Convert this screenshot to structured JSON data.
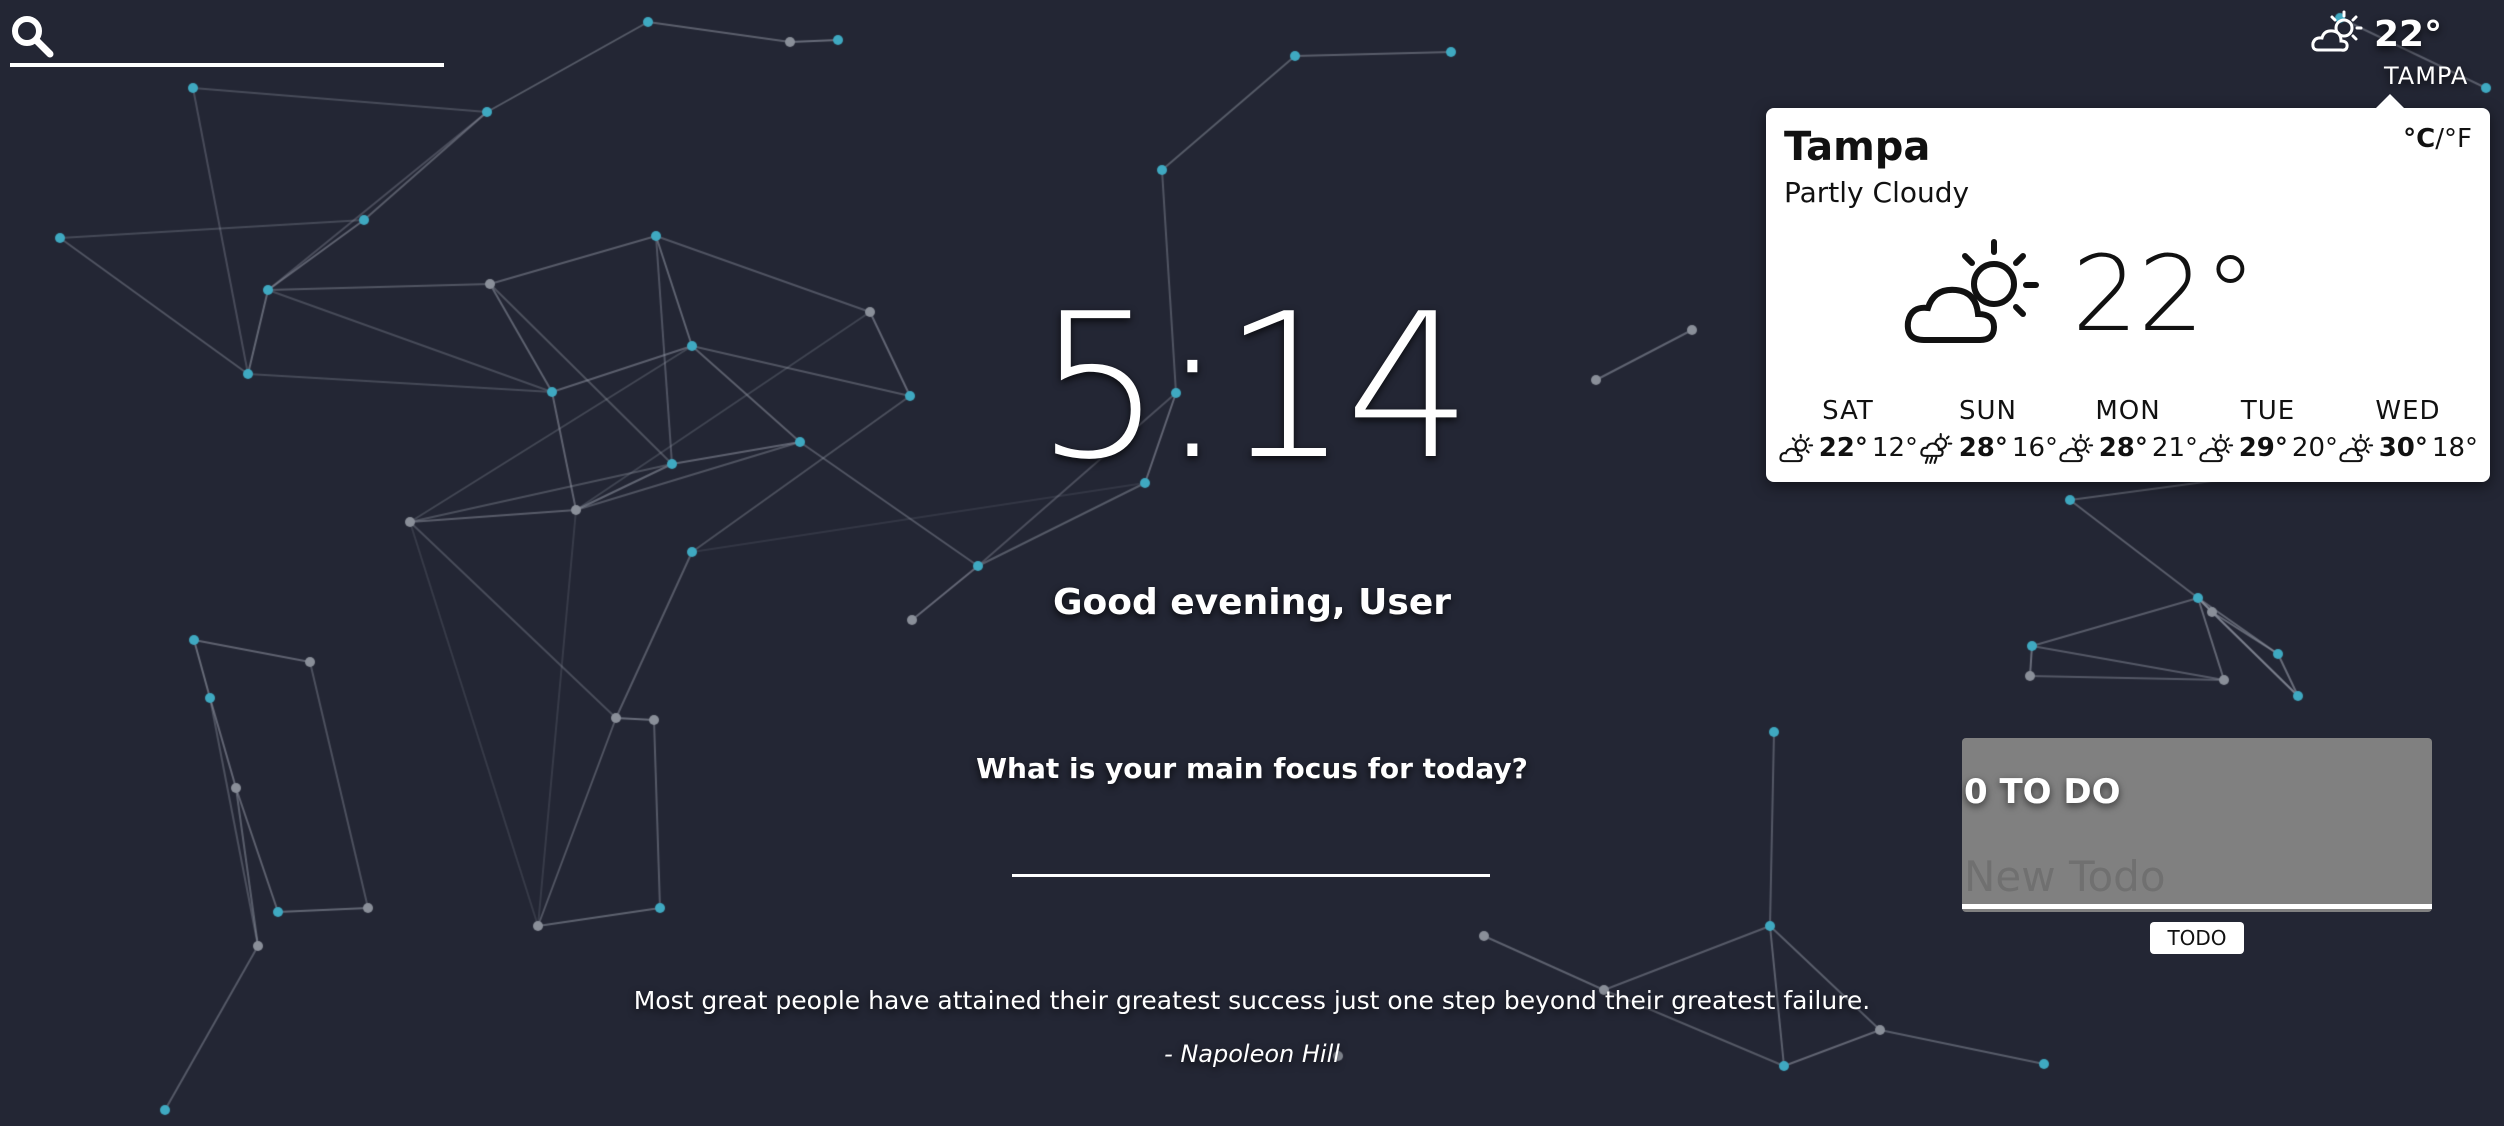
{
  "search": {
    "placeholder": "",
    "value": ""
  },
  "weather_mini": {
    "temp": "22°",
    "city": "TAMPA",
    "icon": "partly-cloudy-icon"
  },
  "weather_card": {
    "city": "Tampa",
    "condition": "Partly Cloudy",
    "unit_c": "°C",
    "unit_sep": "/",
    "unit_f": "°F",
    "temp": "22°",
    "icon": "partly-cloudy-icon",
    "forecast": [
      {
        "day": "SAT",
        "hi": "22°",
        "lo": "12°",
        "icon": "partly-cloudy-icon"
      },
      {
        "day": "SUN",
        "hi": "28°",
        "lo": "16°",
        "icon": "rain-icon"
      },
      {
        "day": "MON",
        "hi": "28°",
        "lo": "21°",
        "icon": "partly-cloudy-icon"
      },
      {
        "day": "TUE",
        "hi": "29°",
        "lo": "20°",
        "icon": "partly-cloudy-icon"
      },
      {
        "day": "WED",
        "hi": "30°",
        "lo": "18°",
        "icon": "partly-cloudy-icon"
      }
    ]
  },
  "clock": {
    "time": "5:14"
  },
  "greeting": "Good evening, User",
  "focus": {
    "question": "What is your main focus for today?",
    "value": ""
  },
  "quote": {
    "text": "Most great people have attained their greatest success just one step beyond their greatest failure.",
    "author": "- Napoleon Hill"
  },
  "todo": {
    "count_label": "0 TO DO",
    "input_placeholder": "New Todo",
    "button_label": "TODO"
  },
  "colors": {
    "background": "#232634",
    "node_teal": "#3fa9c1",
    "node_gray": "#8a8f99",
    "link": "#6f7481",
    "todo_panel": "#808080"
  }
}
